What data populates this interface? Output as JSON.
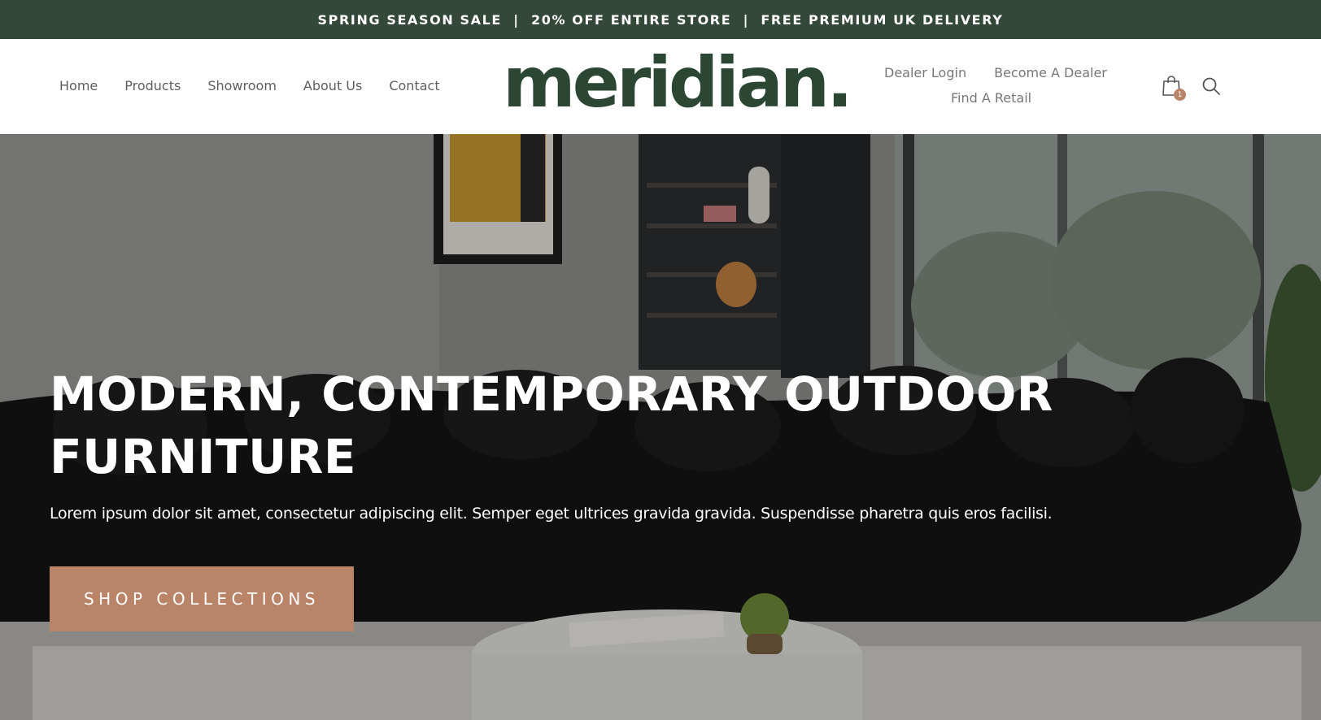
{
  "announcement": {
    "text": "SPRING SEASON SALE  |  20% OFF ENTIRE STORE  |  FREE PREMIUM UK DELIVERY"
  },
  "header": {
    "nav_left": [
      {
        "label": "Home"
      },
      {
        "label": "Products"
      },
      {
        "label": "Showroom"
      },
      {
        "label": "About Us"
      },
      {
        "label": "Contact"
      }
    ],
    "logo": {
      "text": "meridian",
      "dot": "."
    },
    "nav_right": {
      "dealer_login": "Dealer Login",
      "become_dealer": "Become A Dealer",
      "find_retail": "Find A Retail"
    },
    "cart": {
      "icon": "shopping-bag-icon",
      "count": "1"
    },
    "search": {
      "icon": "search-icon"
    }
  },
  "hero": {
    "title": "MODERN, CONTEMPORARY OUTDOOR FURNITURE",
    "subtitle": "Lorem ipsum dolor sit amet, consectetur adipiscing elit. Semper eget ultrices gravida gravida. Suspendisse pharetra quis eros facilisi.",
    "button_label": "SHOP COLLECTIONS"
  },
  "colors": {
    "announcement_bg": "#34483a",
    "logo": "#2c4634",
    "accent": "#b98468"
  }
}
